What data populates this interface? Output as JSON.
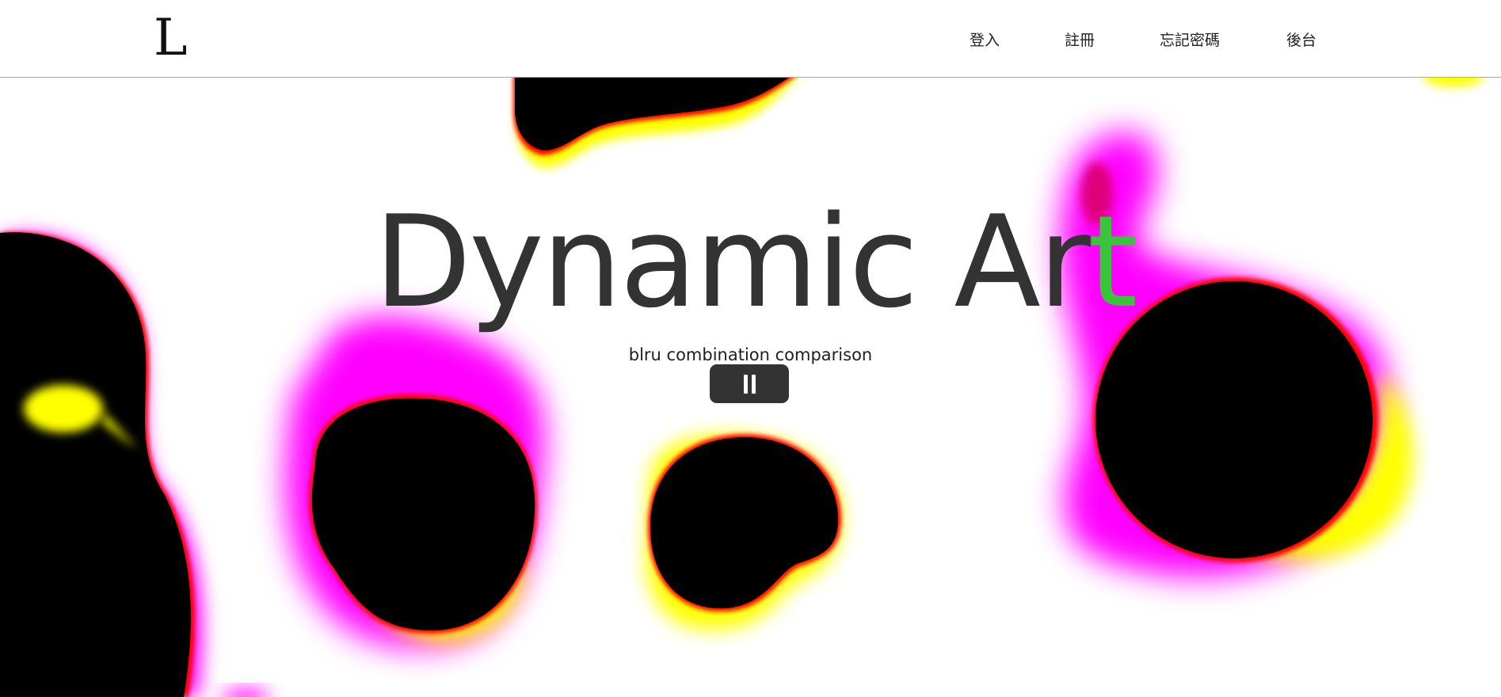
{
  "header": {
    "logo": "L",
    "nav": [
      {
        "label": "登入"
      },
      {
        "label": "註冊"
      },
      {
        "label": "忘記密碼"
      },
      {
        "label": "後台"
      }
    ]
  },
  "hero": {
    "title_main": "Dynamic Ar",
    "title_accent": "t",
    "subtitle": "blru combination comparison",
    "pause_icon": "pause-icon"
  },
  "colors": {
    "text": "#333333",
    "accent": "#3ac43a",
    "blob_core": "#000000",
    "blob_magenta": "#ff00ff",
    "blob_yellow": "#ffff00",
    "blob_edge": "#ff0000",
    "button_bg": "#333333"
  }
}
